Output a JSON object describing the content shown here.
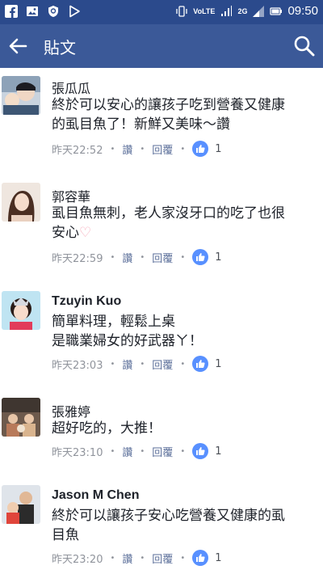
{
  "status_bar": {
    "time": "09:50",
    "volte_label": "VoLTE",
    "network_label": "2G"
  },
  "app_bar": {
    "title": "貼文",
    "back_icon": "arrow-left-icon",
    "search_icon": "search-icon"
  },
  "comments": [
    {
      "name": "張瓜瓜",
      "text_line1": "終於可以安心的讓孩子吃到營養又健康",
      "text_line2": "的虱目魚了！新鮮又美味～讚",
      "time": "昨天22:52",
      "like_label": "讚",
      "reply_label": "回覆",
      "likes": "1"
    },
    {
      "name": "郭容華",
      "text_line1": "虱目魚無刺，老人家沒牙口的吃了也很",
      "text_line2": "安心",
      "text_emoji": "♡",
      "time": "昨天22:59",
      "like_label": "讚",
      "reply_label": "回覆",
      "likes": "1"
    },
    {
      "name": "Tzuyin Kuo",
      "text_line1": "簡單料理，輕鬆上桌",
      "text_line2": "是職業婦女的好武器ㄚ！",
      "time": "昨天23:03",
      "like_label": "讚",
      "reply_label": "回覆",
      "likes": "1"
    },
    {
      "name": "張雅婷",
      "text_line1": "超好吃的，大推！",
      "time": "昨天23:10",
      "like_label": "讚",
      "reply_label": "回覆",
      "likes": "1"
    },
    {
      "name": "Jason M Chen",
      "text_line1": "終於可以讓孩子安心吃營養又健康的虱",
      "text_line2": "目魚",
      "time": "昨天23:20",
      "like_label": "讚",
      "reply_label": "回覆",
      "likes": "1"
    }
  ],
  "colors": {
    "status_bar": "#2b4a8c",
    "app_bar": "#3b5998",
    "like_badge": "#5890ff",
    "meta_text": "#90949c"
  }
}
